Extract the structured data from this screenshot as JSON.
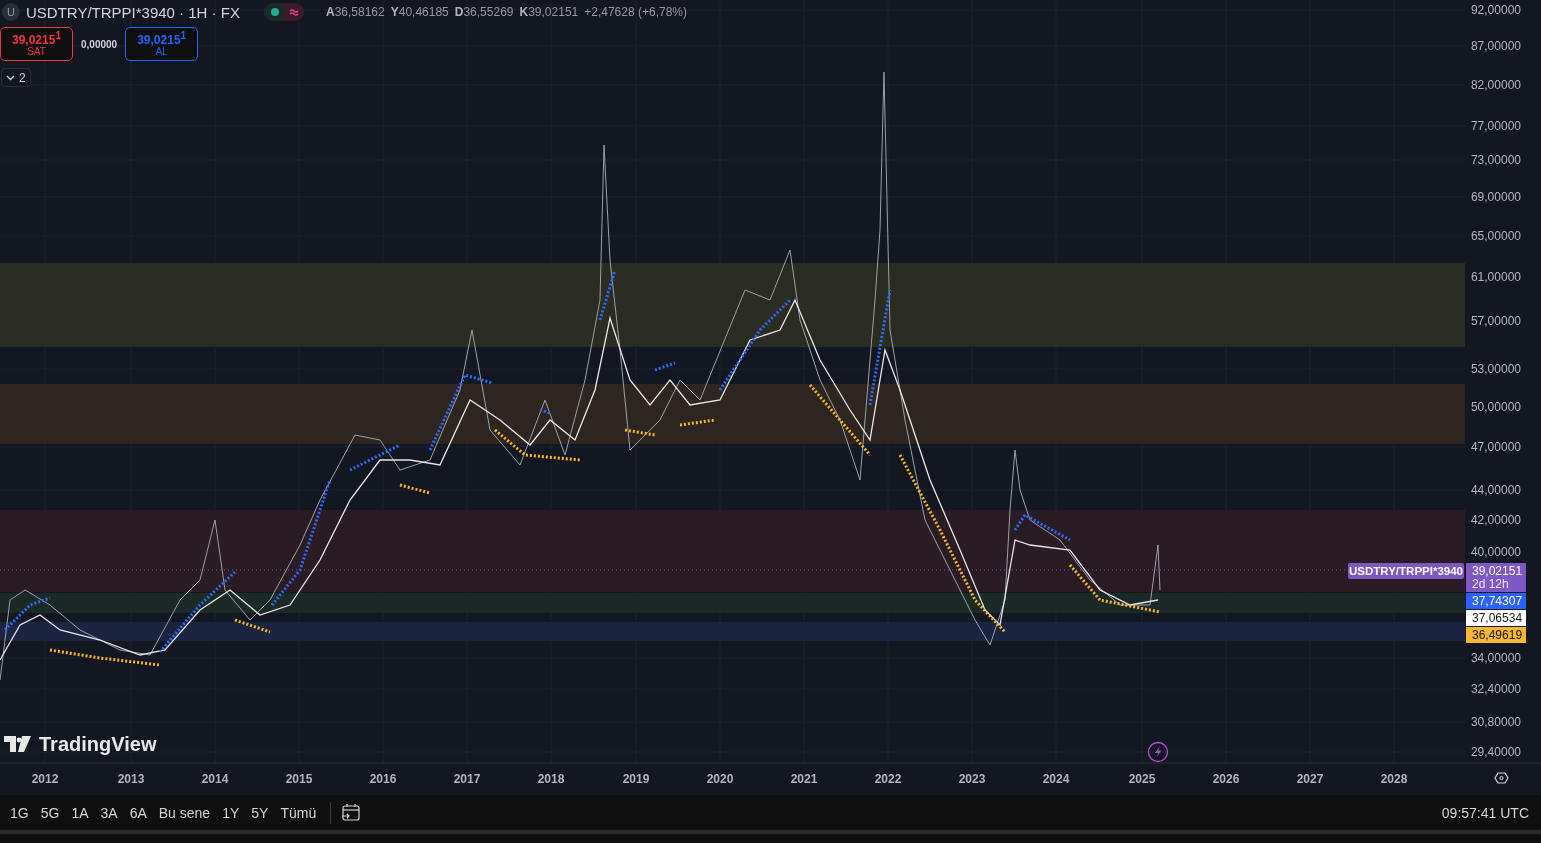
{
  "header": {
    "badge": "U",
    "symbol": "USDTRY/TRPPI*3940 · 1H · FX",
    "ohlc": [
      {
        "key": "A",
        "value": "36,58162"
      },
      {
        "key": "Y",
        "value": "40,46185"
      },
      {
        "key": "D",
        "value": "36,55269"
      },
      {
        "key": "K",
        "value": "39,02151"
      }
    ],
    "change": "+2,47628 (+6,78%)"
  },
  "trade": {
    "sell": {
      "price": "39,0215$^{1}$",
      "label": "SAT"
    },
    "spread": "0,00000",
    "buy": {
      "price": "39,0215$^{1}$",
      "label": "AL"
    }
  },
  "indicators_toggle": {
    "count": "2"
  },
  "logo": "TradingView",
  "zones": [
    {
      "color": "#2b2c22"
    },
    {
      "color": "#2e2520"
    },
    {
      "color": "#2a1b25"
    },
    {
      "color": "#1b2a26"
    },
    {
      "color": "#1b2542"
    }
  ],
  "price_axis": [
    "92,00000",
    "87,00000",
    "82,00000",
    "77,00000",
    "73,00000",
    "69,00000",
    "65,00000",
    "61,00000",
    "57,00000",
    "53,00000",
    "50,00000",
    "47,00000",
    "44,00000",
    "42,00000",
    "40,00000",
    "34,00000",
    "32,40000",
    "30,80000",
    "29,40000"
  ],
  "symbol_tag": "USDTRY/TRPPI*3940",
  "price_tags": [
    {
      "value": "39,02151",
      "sub": "2d 12h",
      "color": "#7e57c2"
    },
    {
      "value": "37,74307",
      "color": "#2962ff"
    },
    {
      "value": "37,06534",
      "color": "#ffffff"
    },
    {
      "value": "36,49619",
      "color": "#f7b731"
    }
  ],
  "time_axis": [
    "2012",
    "2013",
    "2014",
    "2015",
    "2016",
    "2017",
    "2018",
    "2019",
    "2020",
    "2021",
    "2022",
    "2023",
    "2024",
    "2025",
    "2026",
    "2027",
    "2028"
  ],
  "ranges": [
    "1G",
    "5G",
    "1A",
    "3A",
    "6A",
    "Bu sene",
    "1Y",
    "5Y",
    "Tümü"
  ],
  "clock": "09:57:41 UTC"
}
